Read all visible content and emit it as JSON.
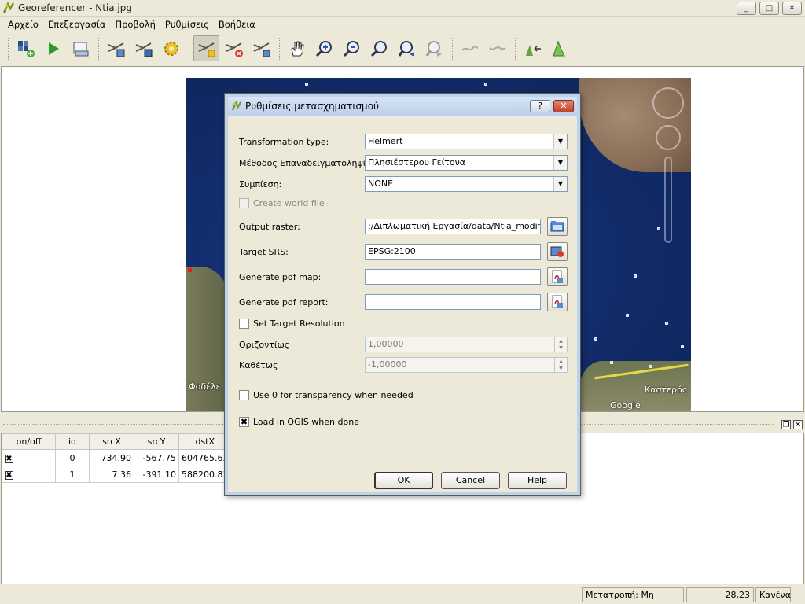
{
  "window": {
    "title": "Georeferencer - Ntia.jpg",
    "minimize": "_",
    "maximize": "□",
    "close": "✕"
  },
  "menu": [
    "Αρχείο",
    "Επεξεργασία",
    "Προβολή",
    "Ρυθμίσεις",
    "Βοήθεια"
  ],
  "toolbar_icons": [
    "open-raster-icon",
    "start-georeferencing-icon",
    "generate-gdal-script-icon",
    "load-gcp-icon",
    "save-gcp-icon",
    "transformation-settings-icon",
    "add-point-icon",
    "delete-point-icon",
    "move-gcp-icon",
    "pan-icon",
    "zoom-in-icon",
    "zoom-out-icon",
    "zoom-to-layer-icon",
    "zoom-last-icon",
    "zoom-next-icon",
    "link-georef-to-qgis-icon",
    "link-qgis-to-georef-icon",
    "full-histogram-stretch-icon",
    "local-histogram-stretch-icon"
  ],
  "map": {
    "labels": [
      "Φοδέλε",
      "Καστερός",
      "Google"
    ]
  },
  "dialog": {
    "title": "Ρυθμίσεις μετασχηματισμού",
    "help_btn": "?",
    "close_btn": "✕",
    "transformation_type_label": "Transformation type:",
    "transformation_type_value": "Helmert",
    "resampling_label": "Μέθοδος Επαναδειγματοληψίας:",
    "resampling_value": "Πλησιέστερου Γείτονα",
    "compression_label": "Συμπίεση:",
    "compression_value": "NONE",
    "create_world_file": "Create world file",
    "output_raster_label": "Output raster:",
    "output_raster_value": ":/Διπλωματική Εργασία/data/Ntia_modified.tif",
    "target_srs_label": "Target SRS:",
    "target_srs_value": "EPSG:2100",
    "pdf_map_label": "Generate pdf map:",
    "pdf_map_value": "",
    "pdf_report_label": "Generate pdf report:",
    "pdf_report_value": "",
    "set_target_resolution": "Set Target Resolution",
    "horizontal_label": "Οριζοντίως",
    "horizontal_value": "1,00000",
    "vertical_label": "Καθέτως",
    "vertical_value": "-1,00000",
    "use_zero_transparency": "Use 0 for transparency when needed",
    "load_in_qgis": "Load in QGIS when done",
    "load_in_qgis_checked": "✖",
    "ok": "OK",
    "cancel": "Cancel",
    "help": "Help"
  },
  "gcp_table": {
    "headers": [
      "on/off",
      "id",
      "srcX",
      "srcY",
      "dstX"
    ],
    "rows": [
      {
        "enabled": "✖",
        "id": "0",
        "srcX": "734.90",
        "srcY": "-567.75",
        "dstX": "604765.63"
      },
      {
        "enabled": "✖",
        "id": "1",
        "srcX": "7.36",
        "srcY": "-391.10",
        "dstX": "588200.83"
      }
    ]
  },
  "dock": {
    "float": "❐",
    "close": "✕"
  },
  "status": {
    "transform": "Μετατροπή: Μη ορισμένο",
    "coords": "28,23",
    "crs": "Κανένα"
  }
}
